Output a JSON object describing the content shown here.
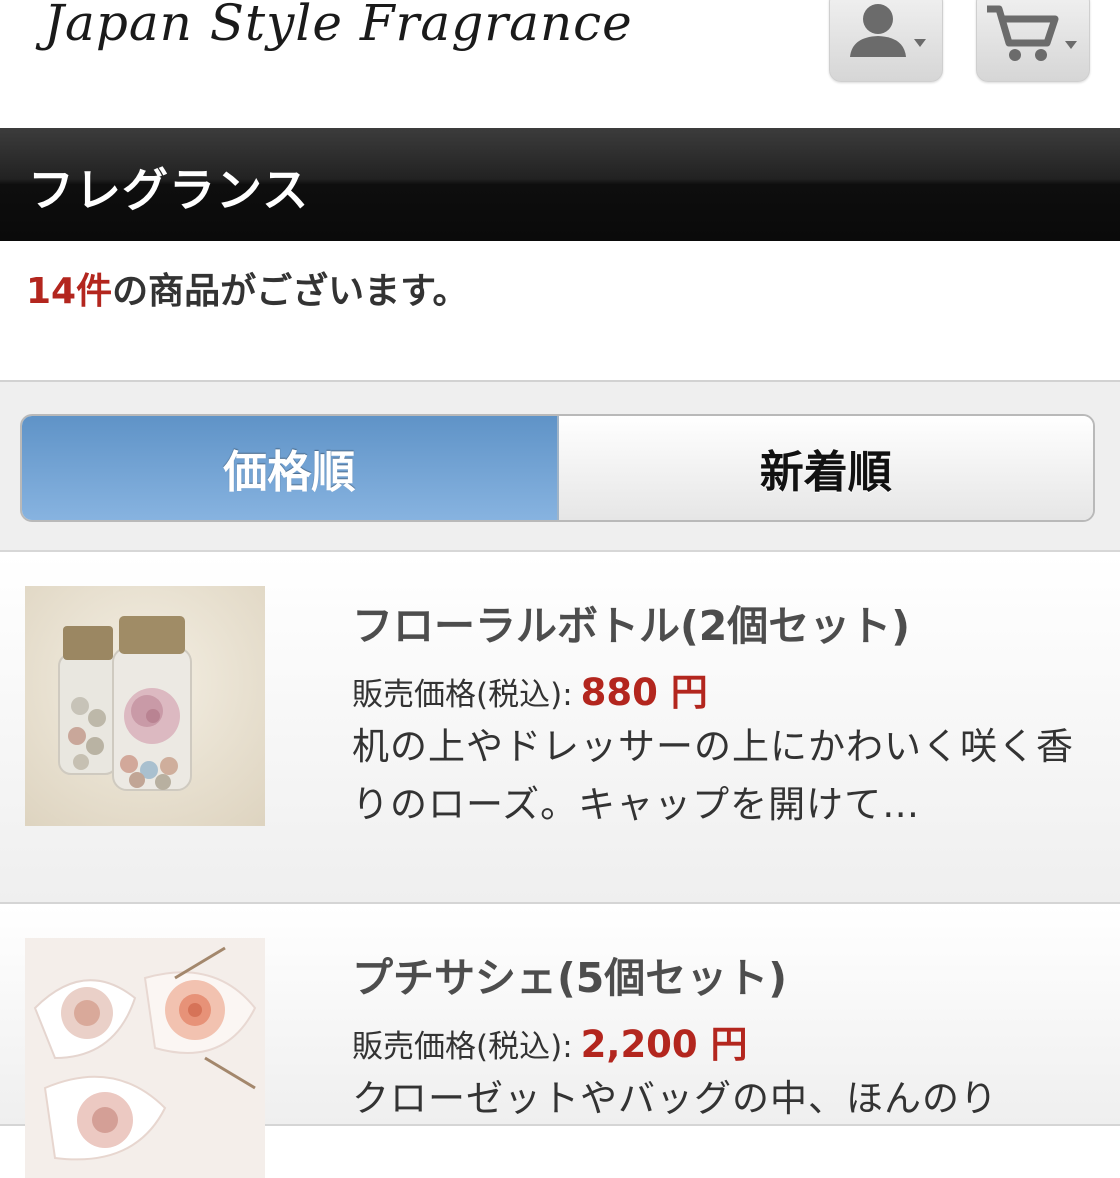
{
  "header": {
    "logo_text": "Japan Style Fragrance",
    "account_icon": "user-dropdown-icon",
    "cart_icon": "cart-dropdown-icon"
  },
  "category": {
    "title": "フレグランス"
  },
  "result": {
    "count": "14件",
    "suffix": "の商品がございます。"
  },
  "sort": {
    "price_label": "価格順",
    "new_label": "新着順",
    "active": "price"
  },
  "products": [
    {
      "name": "フローラルボトル(2個セット)",
      "price_label": "販売価格(税込):",
      "price": "880 円",
      "description": "机の上やドレッサーの上にかわいく咲く香りのローズ。キャップを開けて…"
    },
    {
      "name": "プチサシェ(5個セット)",
      "price_label": "販売価格(税込):",
      "price": "2,200 円",
      "description": "クローゼットやバッグの中、ほんのり"
    }
  ],
  "colors": {
    "accent_red": "#b3261e",
    "active_tab": "#6f9fd3",
    "category_bar": "#111111"
  }
}
